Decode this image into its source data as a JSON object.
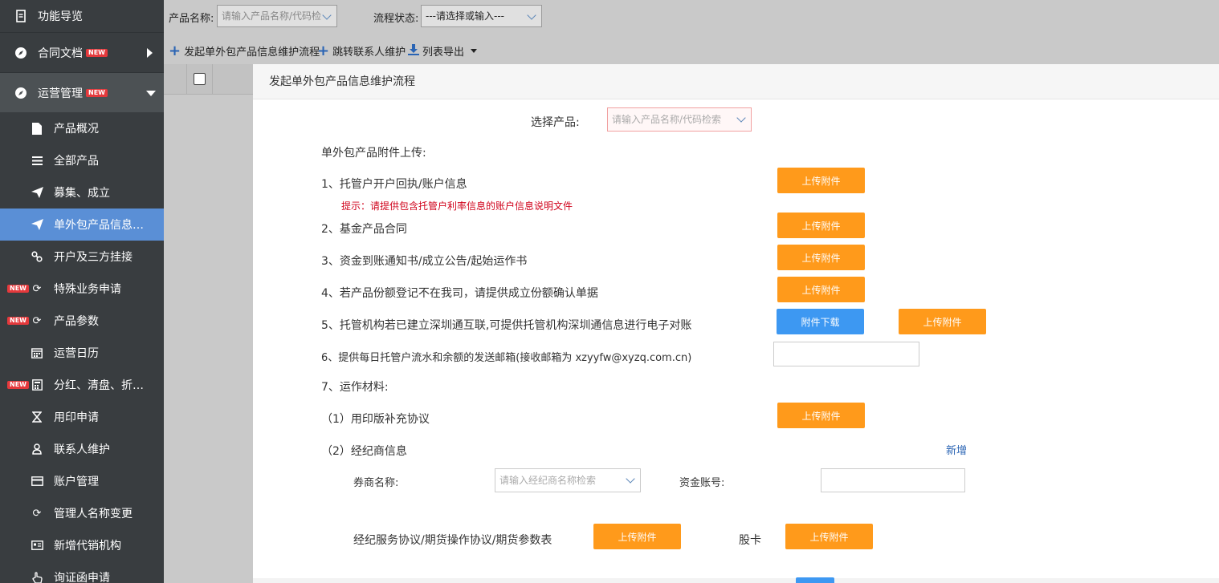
{
  "sidebar": {
    "top": {
      "label": "功能导览",
      "icon": "document-icon"
    },
    "groups": [
      {
        "label": "合同文档",
        "badge": "NEW",
        "icon": "compass-icon"
      },
      {
        "label": "运营管理",
        "badge": "NEW",
        "icon": "compass-icon"
      }
    ],
    "items": [
      {
        "label": "产品概况",
        "icon": "file-icon",
        "badge": ""
      },
      {
        "label": "全部产品",
        "icon": "list-icon",
        "badge": ""
      },
      {
        "label": "募集、成立",
        "icon": "send-icon",
        "badge": ""
      },
      {
        "label": "单外包产品信息…",
        "icon": "send-icon",
        "badge": ""
      },
      {
        "label": "开户及三方挂接",
        "icon": "link-icon",
        "badge": ""
      },
      {
        "label": "特殊业务申请",
        "icon": "refresh-icon",
        "badge": "NEW"
      },
      {
        "label": "产品参数",
        "icon": "refresh-icon",
        "badge": "NEW"
      },
      {
        "label": "运营日历",
        "icon": "calendar-icon",
        "badge": ""
      },
      {
        "label": "分红、清盘、折…",
        "icon": "calculator-icon",
        "badge": "NEW"
      },
      {
        "label": "用印申请",
        "icon": "hourglass-icon",
        "badge": ""
      },
      {
        "label": "联系人维护",
        "icon": "user-icon",
        "badge": ""
      },
      {
        "label": "账户管理",
        "icon": "card-icon",
        "badge": ""
      },
      {
        "label": "管理人名称变更",
        "icon": "refresh-icon",
        "badge": ""
      },
      {
        "label": "新增代销机构",
        "icon": "id-card-icon",
        "badge": ""
      },
      {
        "label": "询证函申请",
        "icon": "hand-icon",
        "badge": ""
      }
    ]
  },
  "filters": {
    "product_label": "产品名称:",
    "product_placeholder": "请输入产品名称/代码检",
    "status_label": "流程状态:",
    "status_value": "---请选择或输入---"
  },
  "toolbar": {
    "start_flow": "发起单外包产品信息维护流程",
    "jump_contact": "跳转联系人维护",
    "export": "列表导出"
  },
  "modal": {
    "title": "发起单外包产品信息维护流程",
    "select_product_label": "选择产品:",
    "select_product_placeholder": "请输入产品名称/代码检索",
    "attachments_title": "单外包产品附件上传:",
    "item1": "1、托管户开户回执/账户信息",
    "item1_hint": "提示：请提供包含托管户利率信息的账户信息说明文件",
    "item2": "2、基金产品合同",
    "item3": "3、资金到账通知书/成立公告/起始运作书",
    "item4": "4、若产品份额登记不在我司，请提供成立份额确认单据",
    "item5": "5、托管机构若已建立深圳通互联,可提供托管机构深圳通信息进行电子对账",
    "item6": "6、提供每日托管户流水和余额的发送邮箱(接收邮箱为 xzyyfw@xyzq.com.cn)",
    "item7": "7、运作材料:",
    "item7_1": "（1）用印版补充协议",
    "item7_2": "（2）经纪商信息",
    "add_link": "新增",
    "broker_label": "券商名称:",
    "broker_placeholder": "请输入经纪商名称检索",
    "account_label": "资金账号:",
    "broker_docs_label": "经纪服务协议/期货操作协议/期货参数表",
    "stock_card_label": "股卡",
    "upload_label": "上传附件",
    "download_label": "附件下载"
  },
  "colors": {
    "upload": "#ff9a1b",
    "download": "#3d98f2",
    "sidebar_active": "#5a8fd6",
    "sidebar_bg": "#393d40"
  }
}
